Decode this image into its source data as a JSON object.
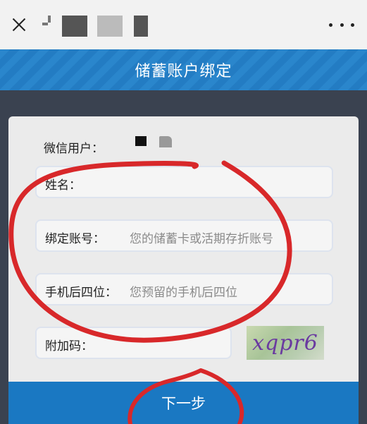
{
  "header": {
    "title_blurred": "",
    "more_label": ""
  },
  "page": {
    "title": "储蓄账户绑定"
  },
  "form": {
    "wechat_user_label": "微信用户：",
    "name_label": "姓名：",
    "account_label": "绑定账号：",
    "account_placeholder": "您的储蓄卡或活期存折账号",
    "phone_label": "手机后四位：",
    "phone_placeholder": "您预留的手机后四位",
    "captcha_label": "附加码：",
    "captcha_text": "xqpr6",
    "next_label": "下一步"
  },
  "colors": {
    "title_bar": "#2a86cc",
    "next_button": "#1a78c2",
    "annotation": "#d8282a"
  }
}
